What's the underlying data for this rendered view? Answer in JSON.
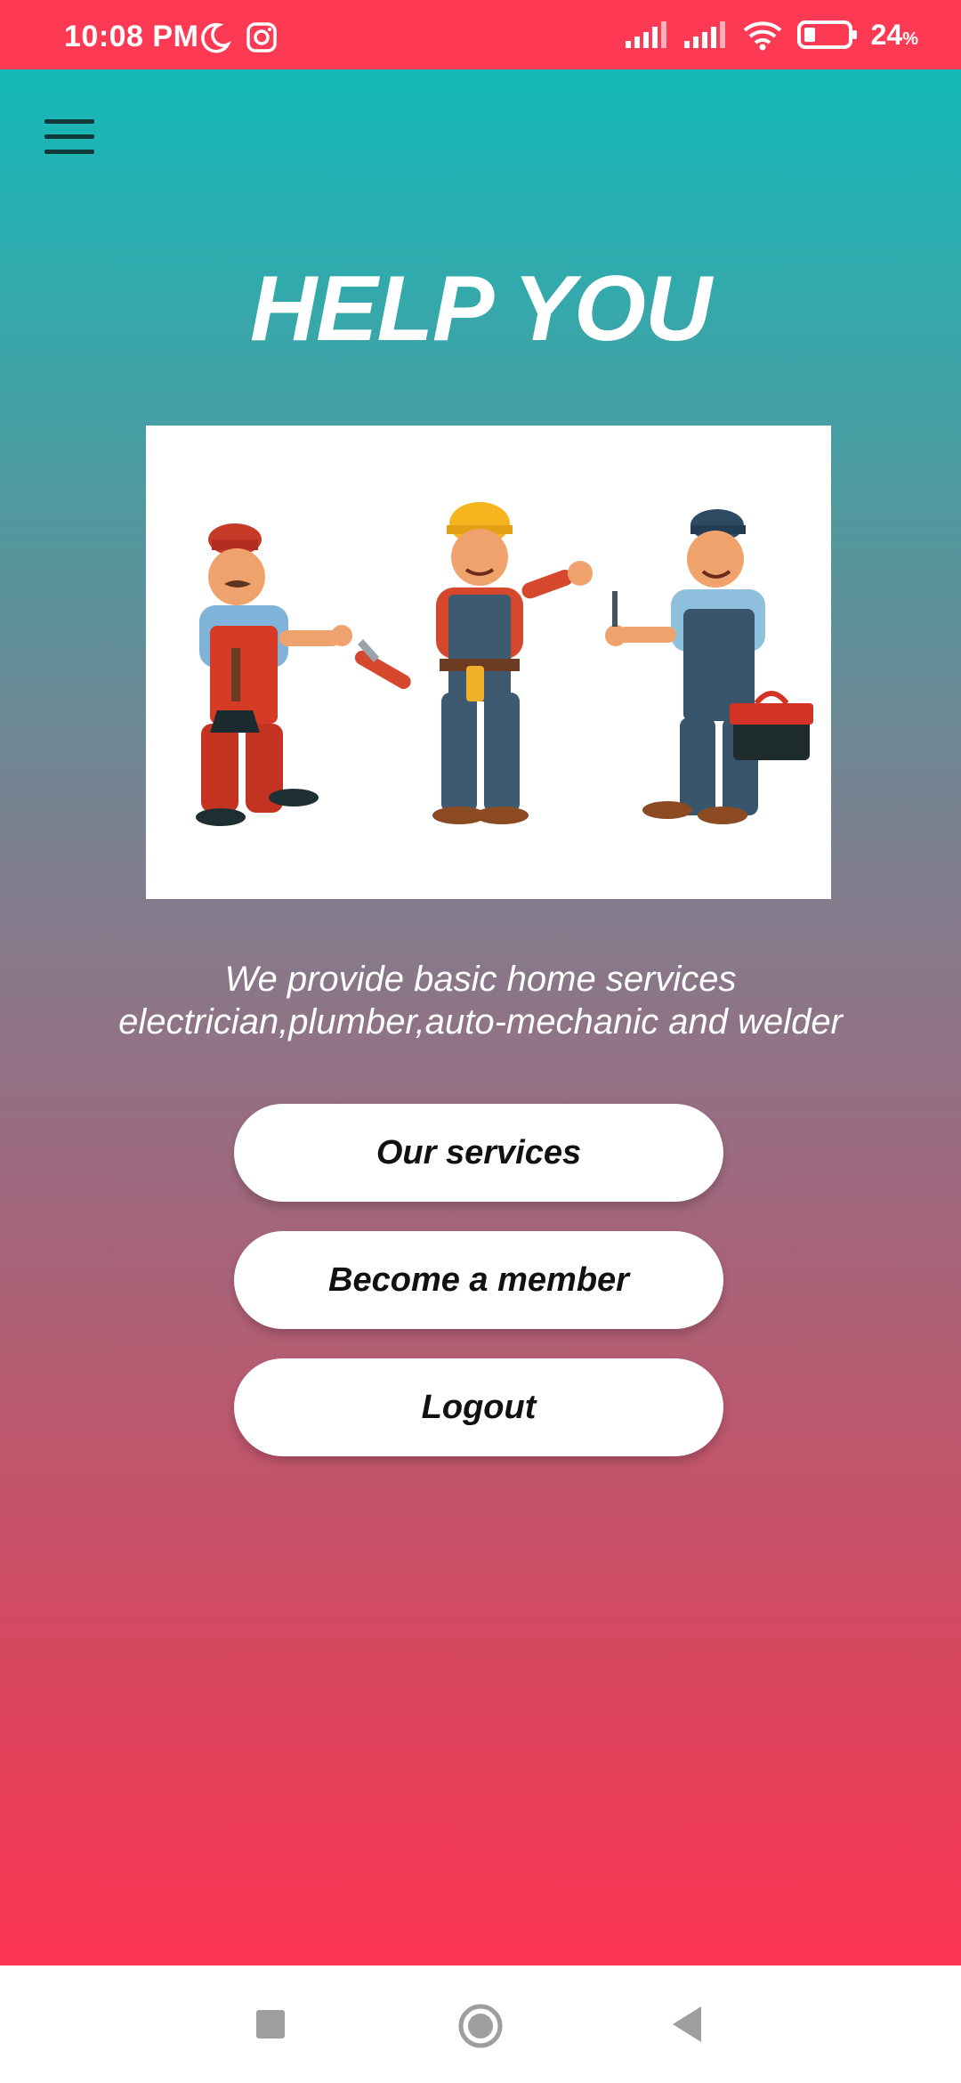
{
  "status_bar": {
    "time": "10:08 PM",
    "battery_percent": "24",
    "battery_unit": "%",
    "icons": [
      "moon-icon",
      "instagram-icon",
      "signal-icon",
      "signal-icon",
      "wifi-icon",
      "battery-icon"
    ],
    "color": "#fe3953"
  },
  "header": {
    "menu_icon": "hamburger-menu-icon"
  },
  "main": {
    "title": "HELP YOU",
    "tagline_line1": "We provide basic home services",
    "tagline_line2": "electrician,plumber,auto-mechanic and welder",
    "hero_image": "workers-illustration"
  },
  "buttons": {
    "services_label": "Our services",
    "member_label": "Become a member",
    "logout_label": "Logout"
  },
  "navigation_bar": {
    "items": [
      "recent-apps-icon",
      "home-icon",
      "back-icon"
    ]
  },
  "colors": {
    "gradient_top": "#14bab9",
    "gradient_bottom": "#fc3552",
    "button_bg": "#ffffff",
    "title_text": "#ffffff"
  }
}
